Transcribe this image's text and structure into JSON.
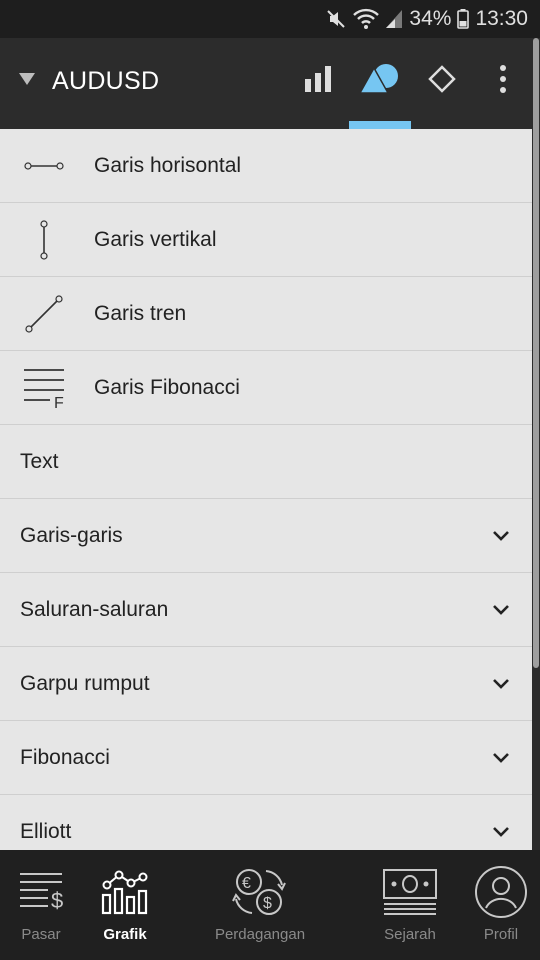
{
  "status": {
    "battery": "34%",
    "time": "13:30"
  },
  "toolbar": {
    "symbol": "AUDUSD"
  },
  "list": {
    "tools": [
      {
        "label": "Garis horisontal",
        "icon": "horizontal-line-icon"
      },
      {
        "label": "Garis vertikal",
        "icon": "vertical-line-icon"
      },
      {
        "label": "Garis tren",
        "icon": "trend-line-icon"
      },
      {
        "label": "Garis Fibonacci",
        "icon": "fibonacci-lines-icon"
      }
    ],
    "text_item": "Text",
    "sections": [
      {
        "label": "Garis-garis"
      },
      {
        "label": "Saluran-saluran"
      },
      {
        "label": "Garpu rumput"
      },
      {
        "label": "Fibonacci"
      },
      {
        "label": "Elliott"
      }
    ]
  },
  "nav": {
    "items": [
      {
        "label": "Pasar",
        "icon": "quotes-icon",
        "active": false
      },
      {
        "label": "Grafik",
        "icon": "chart-icon",
        "active": true
      },
      {
        "label": "Perdagangan",
        "icon": "trade-exchange-icon",
        "active": false
      },
      {
        "label": "Sejarah",
        "icon": "history-banknote-icon",
        "active": false
      },
      {
        "label": "Profil",
        "icon": "profile-icon",
        "active": false
      }
    ]
  },
  "colors": {
    "accent": "#76c6f2",
    "toolbar": "#2c2c2c",
    "list_bg": "#e6e6e6",
    "nav_bg": "#202020"
  }
}
